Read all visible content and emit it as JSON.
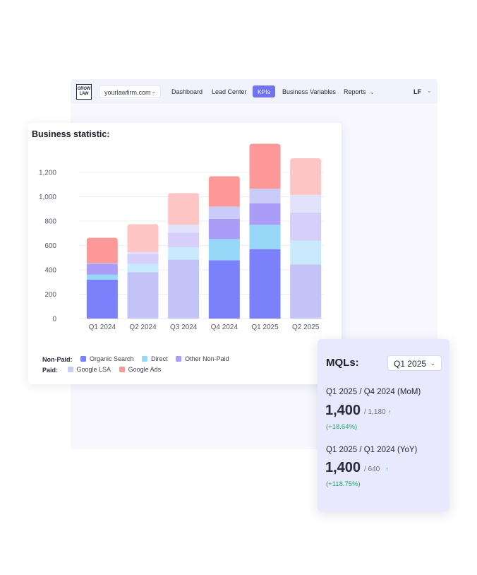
{
  "header": {
    "logo_lines": [
      "GROW",
      "LAW"
    ],
    "domain": "yourlawfirm.com",
    "nav": [
      "Dashboard",
      "Lead Center",
      "KPIs",
      "Business Variables",
      "Reports"
    ],
    "active_nav": "KPIs",
    "user_initials": "LF"
  },
  "chart_card": {
    "title": "Business statistic:",
    "legend": {
      "non_paid_label": "Non-Paid:",
      "paid_label": "Paid:"
    }
  },
  "chart_data": {
    "type": "bar",
    "stacked": true,
    "categories": [
      "Q1 2024",
      "Q2 2024",
      "Q3 2024",
      "Q4 2024",
      "Q1 2025",
      "Q2 2025"
    ],
    "ylim": [
      0,
      1400
    ],
    "yticks": [
      0,
      200,
      400,
      600,
      800,
      1000,
      1200
    ],
    "ytick_labels": [
      "0",
      "200",
      "400",
      "600",
      "800",
      "1,000",
      "1,200"
    ],
    "highlighted_categories": [
      "Q1 2024",
      "Q4 2024",
      "Q1 2025"
    ],
    "series": [
      {
        "name": "Organic Search",
        "group": "Non-Paid",
        "color": "#7b80fb",
        "faded_color": "#c2c4f8",
        "values": [
          320,
          380,
          485,
          478,
          570,
          445
        ]
      },
      {
        "name": "Direct",
        "group": "Non-Paid",
        "color": "#97d8f8",
        "faded_color": "#c9eafc",
        "values": [
          40,
          70,
          100,
          175,
          200,
          195
        ]
      },
      {
        "name": "Other Non-Paid",
        "group": "Non-Paid",
        "color": "#ab9cf8",
        "faded_color": "#d6cefb",
        "values": [
          90,
          80,
          120,
          165,
          175,
          230
        ]
      },
      {
        "name": "Google LSA",
        "group": "Paid",
        "color": "#c9cbf8",
        "faded_color": "#e2e3fb",
        "values": [
          5,
          15,
          65,
          100,
          120,
          145
        ]
      },
      {
        "name": "Google Ads",
        "group": "Paid",
        "color": "#fb9999",
        "faded_color": "#fec5c5",
        "values": [
          208,
          230,
          260,
          250,
          370,
          300
        ]
      }
    ]
  },
  "mql": {
    "title": "MQLs:",
    "period": "Q1 2025",
    "comparisons": [
      {
        "label": "Q1 2025 / Q4 2024 (MoM)",
        "value": "1,400",
        "previous": "/ 1,180",
        "change": "(+18.64%)"
      },
      {
        "label": "Q1 2025 / Q1 2024 (YoY)",
        "value": "1,400",
        "previous": "/ 640",
        "change": "(+118.75%)"
      }
    ]
  }
}
